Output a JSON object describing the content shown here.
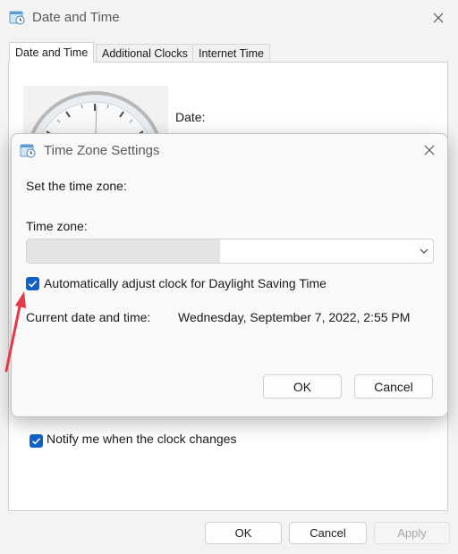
{
  "outer_window": {
    "title": "Date and Time",
    "tabs": [
      {
        "label": "Date and Time",
        "active": true
      },
      {
        "label": "Additional Clocks",
        "active": false
      },
      {
        "label": "Internet Time",
        "active": false
      }
    ],
    "date_label": "Date:",
    "notify_checkbox": {
      "label": "Notify me when the clock changes",
      "checked": true
    },
    "buttons": {
      "ok": "OK",
      "cancel": "Cancel",
      "apply": "Apply"
    }
  },
  "tz_dialog": {
    "title": "Time Zone Settings",
    "set_label": "Set the time zone:",
    "zone_label": "Time zone:",
    "zone_value": "",
    "dst_checkbox": {
      "label": "Automatically adjust clock for Daylight Saving Time",
      "checked": true
    },
    "current_label": "Current date and time:",
    "current_value": "Wednesday, September 7, 2022, 2:55 PM",
    "buttons": {
      "ok": "OK",
      "cancel": "Cancel"
    }
  },
  "icons": {
    "window": "calendar-clock-icon",
    "close": "close-icon",
    "chevron": "chevron-down-icon",
    "check": "check-icon",
    "annotation": "red-arrow-icon"
  },
  "colors": {
    "accent": "#1062c7",
    "annotation": "#e63946",
    "window_bg": "#f3f3f3",
    "dialog_bg": "#f9f9f9"
  }
}
